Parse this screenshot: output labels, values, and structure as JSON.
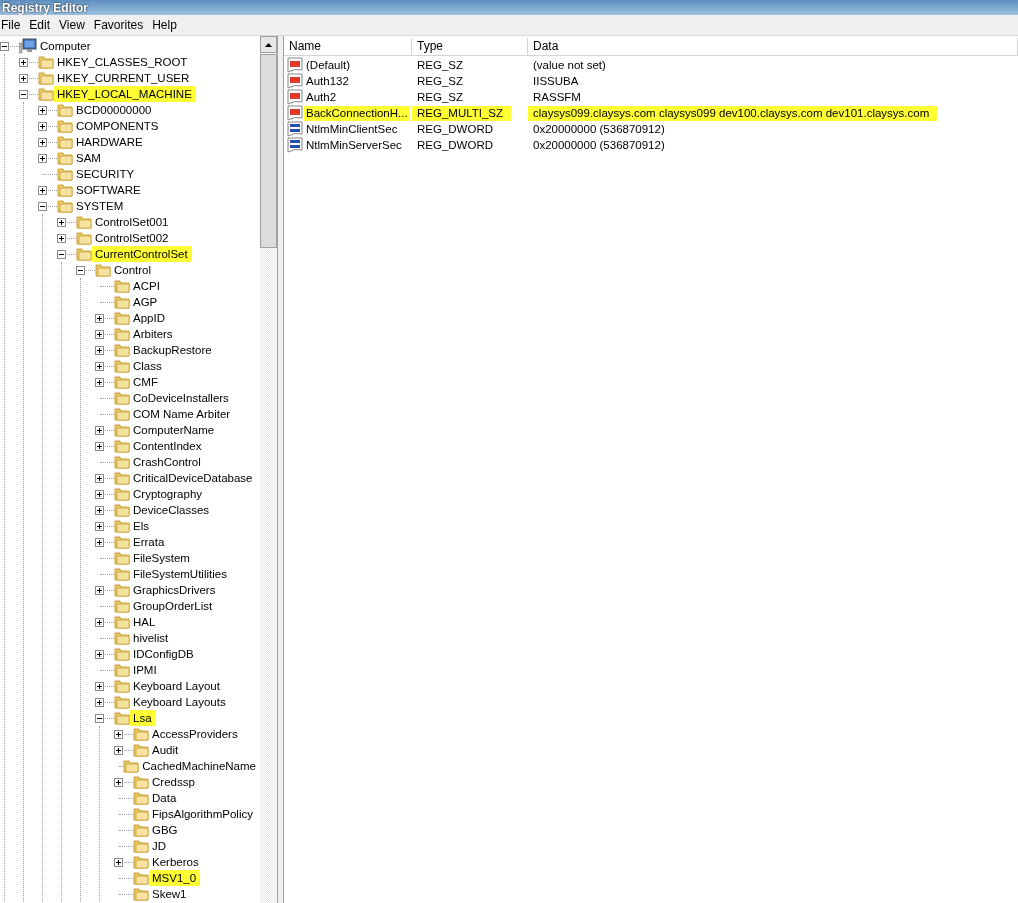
{
  "window": {
    "title": "Registry Editor"
  },
  "menu": [
    "File",
    "Edit",
    "View",
    "Favorites",
    "Help"
  ],
  "tree": {
    "label": "Computer",
    "kind": "computer",
    "expandable": true,
    "expanded": true,
    "highlighted": false,
    "children": [
      {
        "label": "HKEY_CLASSES_ROOT",
        "expandable": true,
        "expanded": false,
        "highlighted": false
      },
      {
        "label": "HKEY_CURRENT_USER",
        "expandable": true,
        "expanded": false,
        "highlighted": false
      },
      {
        "label": "HKEY_LOCAL_MACHINE",
        "expandable": true,
        "expanded": true,
        "highlighted": true,
        "children": [
          {
            "label": "BCD00000000",
            "expandable": true,
            "expanded": false,
            "highlighted": false
          },
          {
            "label": "COMPONENTS",
            "expandable": true,
            "expanded": false,
            "highlighted": false
          },
          {
            "label": "HARDWARE",
            "expandable": true,
            "expanded": false,
            "highlighted": false
          },
          {
            "label": "SAM",
            "expandable": true,
            "expanded": false,
            "highlighted": false
          },
          {
            "label": "SECURITY",
            "expandable": false,
            "expanded": false,
            "highlighted": false
          },
          {
            "label": "SOFTWARE",
            "expandable": true,
            "expanded": false,
            "highlighted": false
          },
          {
            "label": "SYSTEM",
            "expandable": true,
            "expanded": true,
            "highlighted": false,
            "children": [
              {
                "label": "ControlSet001",
                "expandable": true,
                "expanded": false,
                "highlighted": false
              },
              {
                "label": "ControlSet002",
                "expandable": true,
                "expanded": false,
                "highlighted": false
              },
              {
                "label": "CurrentControlSet",
                "expandable": true,
                "expanded": true,
                "highlighted": true,
                "children": [
                  {
                    "label": "Control",
                    "expandable": true,
                    "expanded": true,
                    "highlighted": false,
                    "children": [
                      {
                        "label": "ACPI",
                        "expandable": false,
                        "expanded": false,
                        "highlighted": false
                      },
                      {
                        "label": "AGP",
                        "expandable": false,
                        "expanded": false,
                        "highlighted": false
                      },
                      {
                        "label": "AppID",
                        "expandable": true,
                        "expanded": false,
                        "highlighted": false
                      },
                      {
                        "label": "Arbiters",
                        "expandable": true,
                        "expanded": false,
                        "highlighted": false
                      },
                      {
                        "label": "BackupRestore",
                        "expandable": true,
                        "expanded": false,
                        "highlighted": false
                      },
                      {
                        "label": "Class",
                        "expandable": true,
                        "expanded": false,
                        "highlighted": false
                      },
                      {
                        "label": "CMF",
                        "expandable": true,
                        "expanded": false,
                        "highlighted": false
                      },
                      {
                        "label": "CoDeviceInstallers",
                        "expandable": false,
                        "expanded": false,
                        "highlighted": false
                      },
                      {
                        "label": "COM Name Arbiter",
                        "expandable": false,
                        "expanded": false,
                        "highlighted": false
                      },
                      {
                        "label": "ComputerName",
                        "expandable": true,
                        "expanded": false,
                        "highlighted": false
                      },
                      {
                        "label": "ContentIndex",
                        "expandable": true,
                        "expanded": false,
                        "highlighted": false
                      },
                      {
                        "label": "CrashControl",
                        "expandable": false,
                        "expanded": false,
                        "highlighted": false
                      },
                      {
                        "label": "CriticalDeviceDatabase",
                        "expandable": true,
                        "expanded": false,
                        "highlighted": false
                      },
                      {
                        "label": "Cryptography",
                        "expandable": true,
                        "expanded": false,
                        "highlighted": false
                      },
                      {
                        "label": "DeviceClasses",
                        "expandable": true,
                        "expanded": false,
                        "highlighted": false
                      },
                      {
                        "label": "Els",
                        "expandable": true,
                        "expanded": false,
                        "highlighted": false
                      },
                      {
                        "label": "Errata",
                        "expandable": true,
                        "expanded": false,
                        "highlighted": false
                      },
                      {
                        "label": "FileSystem",
                        "expandable": false,
                        "expanded": false,
                        "highlighted": false
                      },
                      {
                        "label": "FileSystemUtilities",
                        "expandable": false,
                        "expanded": false,
                        "highlighted": false
                      },
                      {
                        "label": "GraphicsDrivers",
                        "expandable": true,
                        "expanded": false,
                        "highlighted": false
                      },
                      {
                        "label": "GroupOrderList",
                        "expandable": false,
                        "expanded": false,
                        "highlighted": false
                      },
                      {
                        "label": "HAL",
                        "expandable": true,
                        "expanded": false,
                        "highlighted": false
                      },
                      {
                        "label": "hivelist",
                        "expandable": false,
                        "expanded": false,
                        "highlighted": false
                      },
                      {
                        "label": "IDConfigDB",
                        "expandable": true,
                        "expanded": false,
                        "highlighted": false
                      },
                      {
                        "label": "IPMI",
                        "expandable": false,
                        "expanded": false,
                        "highlighted": false
                      },
                      {
                        "label": "Keyboard Layout",
                        "expandable": true,
                        "expanded": false,
                        "highlighted": false
                      },
                      {
                        "label": "Keyboard Layouts",
                        "expandable": true,
                        "expanded": false,
                        "highlighted": false
                      },
                      {
                        "label": "Lsa",
                        "expandable": true,
                        "expanded": true,
                        "highlighted": true,
                        "children": [
                          {
                            "label": "AccessProviders",
                            "expandable": true,
                            "expanded": false,
                            "highlighted": false
                          },
                          {
                            "label": "Audit",
                            "expandable": true,
                            "expanded": false,
                            "highlighted": false
                          },
                          {
                            "label": "CachedMachineName",
                            "expandable": false,
                            "expanded": false,
                            "highlighted": false
                          },
                          {
                            "label": "Credssp",
                            "expandable": true,
                            "expanded": false,
                            "highlighted": false
                          },
                          {
                            "label": "Data",
                            "expandable": false,
                            "expanded": false,
                            "highlighted": false
                          },
                          {
                            "label": "FipsAlgorithmPolicy",
                            "expandable": false,
                            "expanded": false,
                            "highlighted": false
                          },
                          {
                            "label": "GBG",
                            "expandable": false,
                            "expanded": false,
                            "highlighted": false
                          },
                          {
                            "label": "JD",
                            "expandable": false,
                            "expanded": false,
                            "highlighted": false
                          },
                          {
                            "label": "Kerberos",
                            "expandable": true,
                            "expanded": false,
                            "highlighted": false
                          },
                          {
                            "label": "MSV1_0",
                            "expandable": false,
                            "expanded": false,
                            "highlighted": true
                          },
                          {
                            "label": "Skew1",
                            "expandable": false,
                            "expanded": false,
                            "highlighted": false
                          }
                        ]
                      }
                    ]
                  }
                ]
              }
            ]
          }
        ]
      }
    ]
  },
  "values": {
    "columns": [
      "Name",
      "Type",
      "Data"
    ],
    "rows": [
      {
        "kind": "string",
        "name": "(Default)",
        "type": "REG_SZ",
        "data": "(value not set)",
        "highlighted": false
      },
      {
        "kind": "string",
        "name": "Auth132",
        "type": "REG_SZ",
        "data": "IISSUBA",
        "highlighted": false
      },
      {
        "kind": "string",
        "name": "Auth2",
        "type": "REG_SZ",
        "data": "RASSFM",
        "highlighted": false
      },
      {
        "kind": "string",
        "name": "BackConnectionH...",
        "type": "REG_MULTI_SZ",
        "data": "claysys099.claysys.com claysys099 dev100.claysys.com dev101.claysys.com",
        "highlighted": true
      },
      {
        "kind": "binary",
        "name": "NtlmMinClientSec",
        "type": "REG_DWORD",
        "data": "0x20000000 (536870912)",
        "highlighted": false
      },
      {
        "kind": "binary",
        "name": "NtlmMinServerSec",
        "type": "REG_DWORD",
        "data": "0x20000000 (536870912)",
        "highlighted": false
      }
    ]
  }
}
